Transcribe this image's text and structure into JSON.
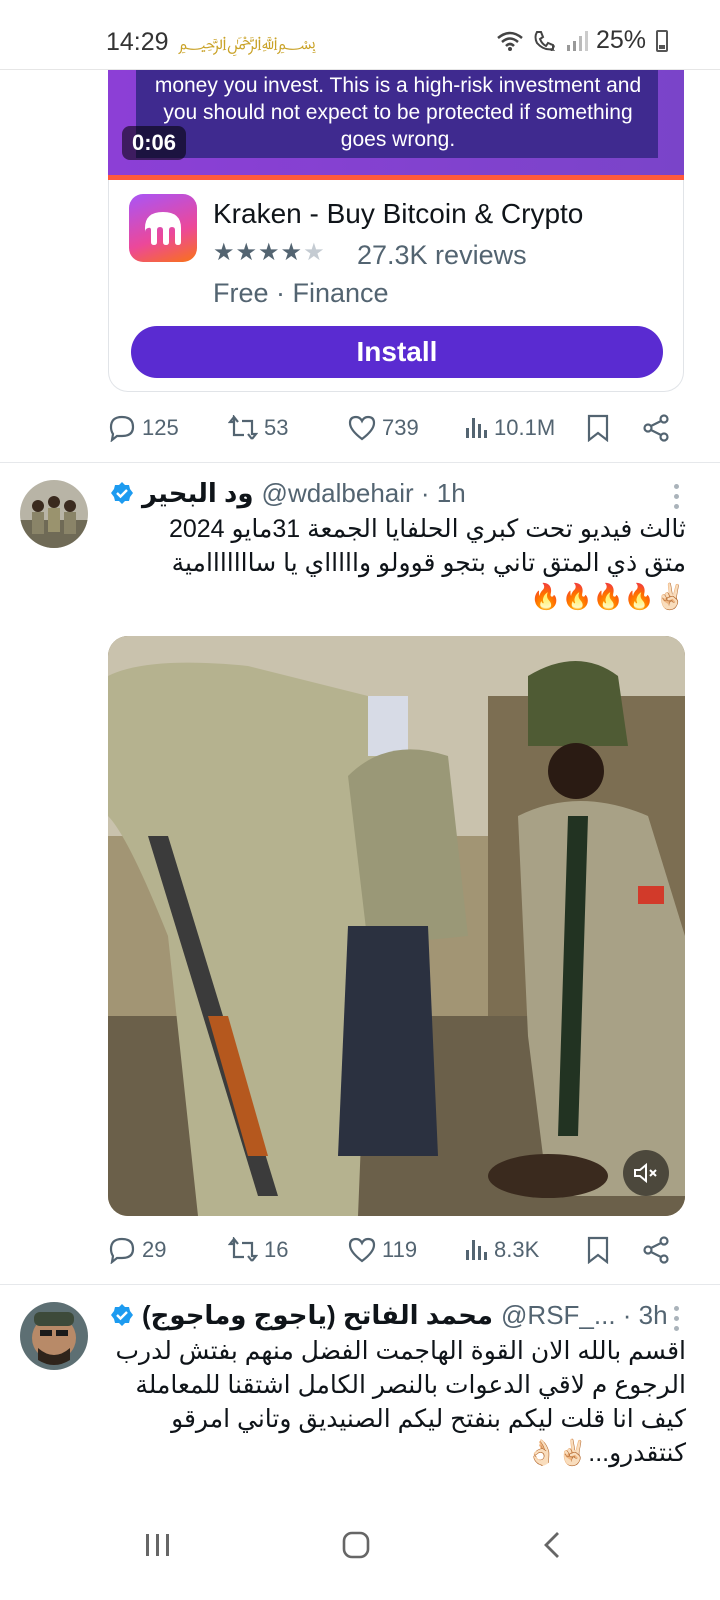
{
  "status": {
    "time": "14:29",
    "battery": "25%"
  },
  "ad": {
    "video_text": "money you invest. This is a high-risk investment and you should not expect to be protected if something goes wrong.",
    "timer": "0:06",
    "app_name": "Kraken - Buy Bitcoin & Crypto",
    "rating": 4.5,
    "reviews": "27.3K reviews",
    "meta": "Free · Finance",
    "install_label": "Install",
    "stats": {
      "replies": "125",
      "reposts": "53",
      "likes": "739",
      "views": "10.1M"
    }
  },
  "tweets": [
    {
      "name": "ود البحير",
      "handle": "@wdalbehair · 1h",
      "lines": [
        "ثالث فيديو تحت كبري الحلفايا الجمعة 31مايو 2024",
        "متق ذي المتق تاني بتجو قوولو واااااي يا سااااااامية",
        "✌🏻🔥🔥🔥🔥"
      ],
      "stats": {
        "replies": "29",
        "reposts": "16",
        "likes": "119",
        "views": "8.3K"
      }
    },
    {
      "name": "محمد الفاتح (ياجوج وماجوج)",
      "handle": "@RSF_... · 3h",
      "lines": [
        "اقسم بالله الان القوة الهاجمت الفضل منهم بفتش لدرب",
        "الرجوع م لاقي الدعوات بالنصر الكامل اشتقنا للمعاملة",
        "كيف انا قلت ليكم بنفتح ليكم الصنيديق وتاني امرقو",
        "كنتقدرو...✌🏻👌🏻"
      ]
    }
  ],
  "colors": {
    "accent": "#1d9bf0",
    "install_button": "#5a2bd1",
    "secondary_text": "#536471"
  }
}
